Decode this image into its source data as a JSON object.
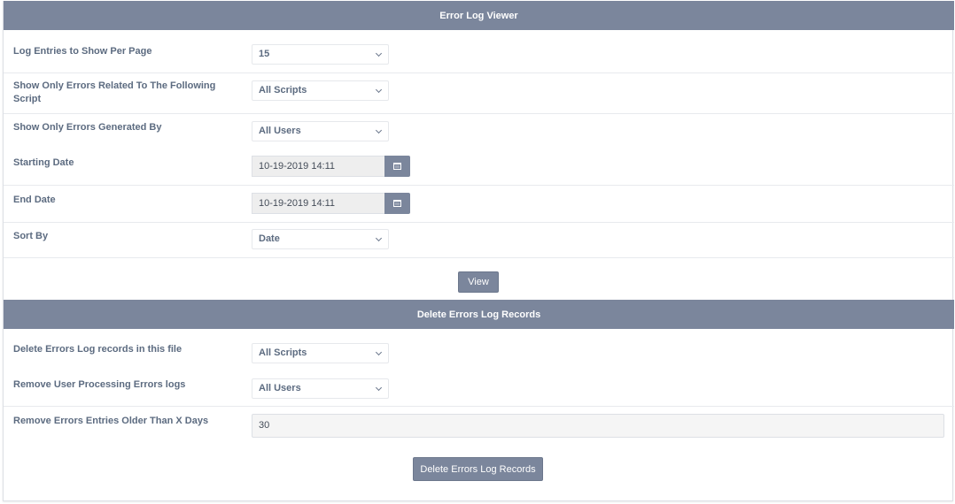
{
  "viewer": {
    "title": "Error Log Viewer",
    "rows": {
      "per_page": {
        "label": "Log Entries to Show Per Page",
        "value": "15"
      },
      "script": {
        "label": "Show Only Errors Related To The Following Script",
        "value": "All Scripts"
      },
      "generated_by": {
        "label": "Show Only Errors Generated By",
        "value": "All Users"
      },
      "start_date": {
        "label": "Starting Date",
        "value": "10-19-2019 14:11"
      },
      "end_date": {
        "label": "End Date",
        "value": "10-19-2019 14:11"
      },
      "sort_by": {
        "label": "Sort By",
        "value": "Date"
      }
    },
    "view_button": "View"
  },
  "delete": {
    "title": "Delete Errors Log Records",
    "rows": {
      "file": {
        "label": "Delete Errors Log records in this file",
        "value": "All Scripts"
      },
      "user": {
        "label": "Remove User Processing Errors logs",
        "value": "All Users"
      },
      "older_than": {
        "label": "Remove Errors Entries Older Than X Days",
        "value": "30"
      }
    },
    "delete_button": "Delete Errors Log Records"
  },
  "icons": {
    "calendar": "calendar-icon",
    "dropdown": "chevron-down-icon"
  },
  "colors": {
    "header_bg": "#7b869c",
    "button_bg": "#7b869c",
    "label_text": "#5c6b80"
  }
}
